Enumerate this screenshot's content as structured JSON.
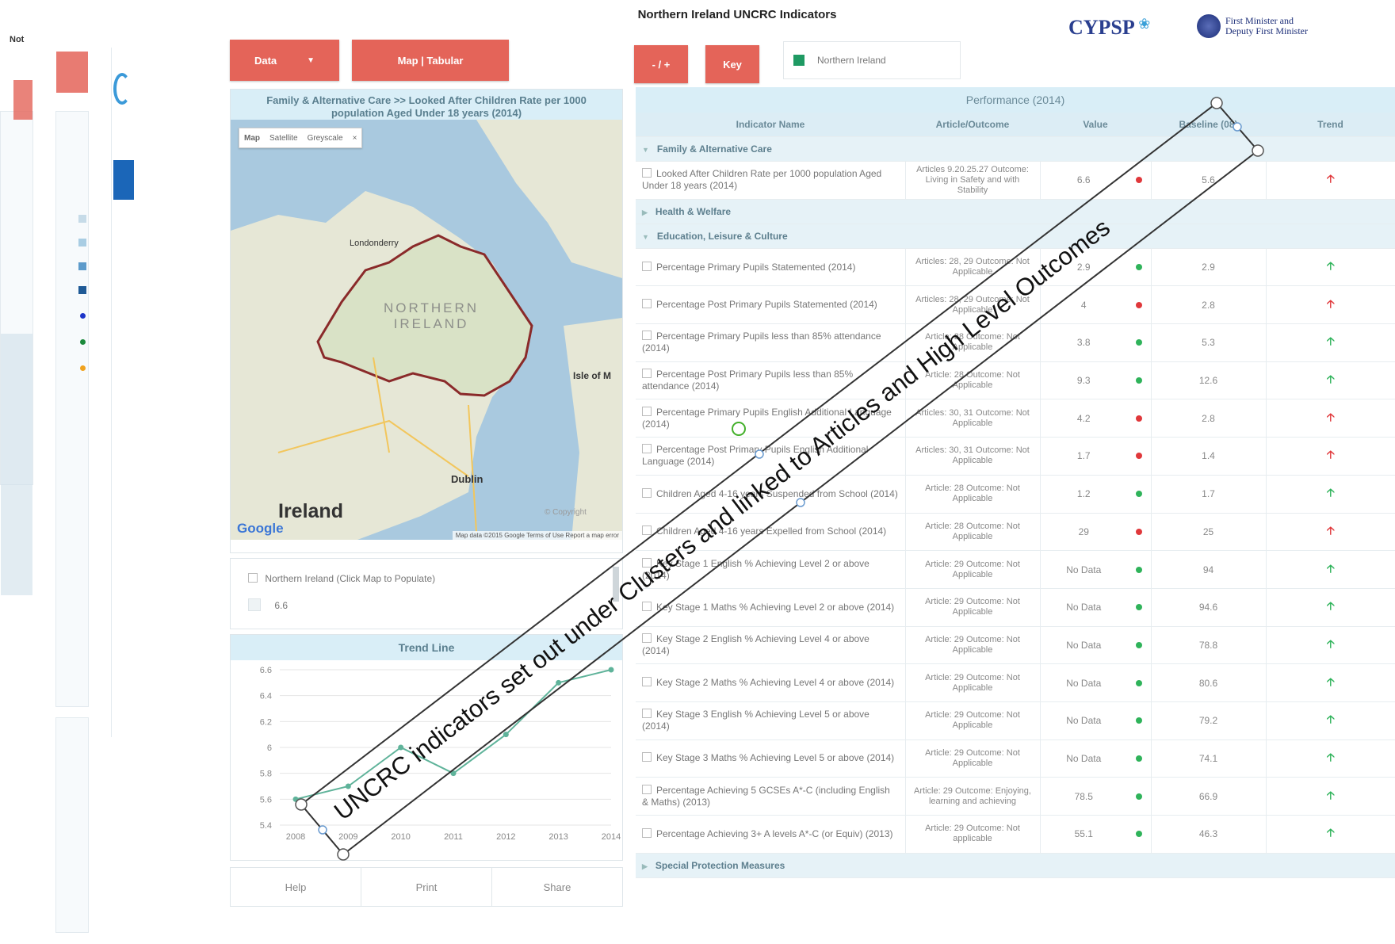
{
  "page_title": "Northern Ireland UNCRC Indicators",
  "ghost_left_label": "Not",
  "logos": {
    "cypsp": "CYPSP",
    "ofmdfm_line1": "First Minister and",
    "ofmdfm_line2": "Deputy First Minister"
  },
  "toolbar": {
    "data_label": "Data",
    "map_tabular_label": "Map | Tabular",
    "minus_plus_label": "- / +",
    "key_label": "Key",
    "legend_item": "Northern Ireland",
    "legend_color": "#1f9a63"
  },
  "map_panel": {
    "title": "Family & Alternative Care >>  Looked After Children Rate per 1000 population Aged Under 18 years (2014)",
    "tabs": [
      "Map",
      "Satellite",
      "Greyscale"
    ],
    "labels": {
      "ni": "NORTHERN IRELAND",
      "ireland": "Ireland",
      "dublin": "Dublin",
      "londonderry": "Londonderry",
      "isle": "Isle of M",
      "copyright": "© Copyright",
      "mapdata": "Map data ©2015 Google   Terms of Use   Report a map error",
      "google": "Google"
    }
  },
  "legend_panel": {
    "checkbox_label": "Northern Ireland (Click Map to Populate)",
    "value": "6.6"
  },
  "trend_panel": {
    "title": "Trend Line",
    "y_ticks": [
      "6.6",
      "6.4",
      "6.2",
      "6",
      "5.8",
      "5.6",
      "5.4"
    ],
    "x_ticks": [
      "2008",
      "2009",
      "2010",
      "2011",
      "2012",
      "2013",
      "2014"
    ]
  },
  "chart_data": {
    "type": "line",
    "x": [
      2008,
      2009,
      2010,
      2011,
      2012,
      2013,
      2014
    ],
    "series": [
      {
        "values": [
          5.6,
          5.7,
          6.0,
          5.8,
          6.1,
          6.5,
          6.6
        ]
      }
    ],
    "ylim": [
      5.4,
      6.6
    ],
    "color": "#5fb39a"
  },
  "bottom_buttons": [
    "Help",
    "Print",
    "Share"
  ],
  "table": {
    "performance_header": "Performance (2014)",
    "columns": [
      "Indicator Name",
      "Article/Outcome",
      "Value",
      "Baseline (08)",
      "Trend"
    ],
    "clusters": [
      {
        "name": "Family & Alternative Care",
        "expanded": true,
        "rows": [
          {
            "name": "Looked After Children Rate per 1000 population Aged Under 18 years (2014)",
            "article": "Articles 9.20.25.27 Outcome: Living in Safety and with Stability",
            "value": "6.6",
            "dot": "red",
            "baseline": "5.6",
            "trend": "up-red"
          }
        ]
      },
      {
        "name": "Health & Welfare",
        "expanded": false,
        "rows": []
      },
      {
        "name": "Education, Leisure & Culture",
        "expanded": true,
        "rows": [
          {
            "name": "Percentage Primary Pupils Statemented (2014)",
            "article": "Articles: 28, 29 Outcome: Not Applicable",
            "value": "2.9",
            "dot": "green",
            "baseline": "2.9",
            "trend": "up-green"
          },
          {
            "name": "Percentage Post Primary Pupils Statemented (2014)",
            "article": "Articles: 28, 29 Outcome: Not Applicable",
            "value": "4",
            "dot": "red",
            "baseline": "2.8",
            "trend": "up-red"
          },
          {
            "name": "Percentage Primary Pupils less than 85% attendance (2014)",
            "article": "Article: 28 Outcome: Not Applicable",
            "value": "3.8",
            "dot": "green",
            "baseline": "5.3",
            "trend": "up-green"
          },
          {
            "name": "Percentage Post Primary Pupils less than 85% attendance (2014)",
            "article": "Article: 28 Outcome: Not Applicable",
            "value": "9.3",
            "dot": "green",
            "baseline": "12.6",
            "trend": "up-green"
          },
          {
            "name": "Percentage Primary Pupils English Additional Language (2014)",
            "article": "Articles: 30, 31 Outcome: Not Applicable",
            "value": "4.2",
            "dot": "red",
            "baseline": "2.8",
            "trend": "up-red"
          },
          {
            "name": "Percentage Post Primary Pupils English Additional Language (2014)",
            "article": "Articles: 30, 31 Outcome: Not Applicable",
            "value": "1.7",
            "dot": "red",
            "baseline": "1.4",
            "trend": "up-red"
          },
          {
            "name": "Children Aged 4-16 years Suspended from School (2014)",
            "article": "Article: 28 Outcome: Not Applicable",
            "value": "1.2",
            "dot": "green",
            "baseline": "1.7",
            "trend": "up-green"
          },
          {
            "name": "Children Aged 4-16 years Expelled from School (2014)",
            "article": "Article: 28 Outcome: Not Applicable",
            "value": "29",
            "dot": "red",
            "baseline": "25",
            "trend": "up-red"
          },
          {
            "name": "Key Stage 1 English % Achieving Level 2 or above (2014)",
            "article": "Article: 29 Outcome: Not Applicable",
            "value": "No Data",
            "dot": "green",
            "baseline": "94",
            "trend": "up-green"
          },
          {
            "name": "Key Stage 1 Maths % Achieving Level 2 or above (2014)",
            "article": "Article: 29 Outcome: Not Applicable",
            "value": "No Data",
            "dot": "green",
            "baseline": "94.6",
            "trend": "up-green"
          },
          {
            "name": "Key Stage 2 English % Achieving Level 4 or above (2014)",
            "article": "Article: 29 Outcome: Not Applicable",
            "value": "No Data",
            "dot": "green",
            "baseline": "78.8",
            "trend": "up-green"
          },
          {
            "name": "Key Stage 2 Maths % Achieving Level 4 or above (2014)",
            "article": "Article: 29 Outcome: Not Applicable",
            "value": "No Data",
            "dot": "green",
            "baseline": "80.6",
            "trend": "up-green"
          },
          {
            "name": "Key Stage 3 English % Achieving Level 5 or above (2014)",
            "article": "Article: 29 Outcome: Not Applicable",
            "value": "No Data",
            "dot": "green",
            "baseline": "79.2",
            "trend": "up-green"
          },
          {
            "name": "Key Stage 3 Maths % Achieving Level 5 or above (2014)",
            "article": "Article: 29 Outcome: Not Applicable",
            "value": "No Data",
            "dot": "green",
            "baseline": "74.1",
            "trend": "up-green"
          },
          {
            "name": "Percentage Achieving 5 GCSEs A*-C (including English & Maths) (2013)",
            "article": "Article: 29 Outcome: Enjoying, learning and achieving",
            "value": "78.5",
            "dot": "green",
            "baseline": "66.9",
            "trend": "up-green"
          },
          {
            "name": "Percentage Achieving 3+ A levels A*-C (or Equiv) (2013)",
            "article": "Article: 29 Outcome: Not applicable",
            "value": "55.1",
            "dot": "green",
            "baseline": "46.3",
            "trend": "up-green"
          }
        ]
      },
      {
        "name": "Special Protection Measures",
        "expanded": false,
        "rows": []
      }
    ]
  },
  "annotation": {
    "text": "UNCRC indicators set out under Clusters and linked to Articles and High Level Outcomes"
  },
  "colors": {
    "accent_red": "#e46459",
    "header_blue": "#d9eef7",
    "status_green": "#2fb35a",
    "status_red": "#e0383b"
  }
}
